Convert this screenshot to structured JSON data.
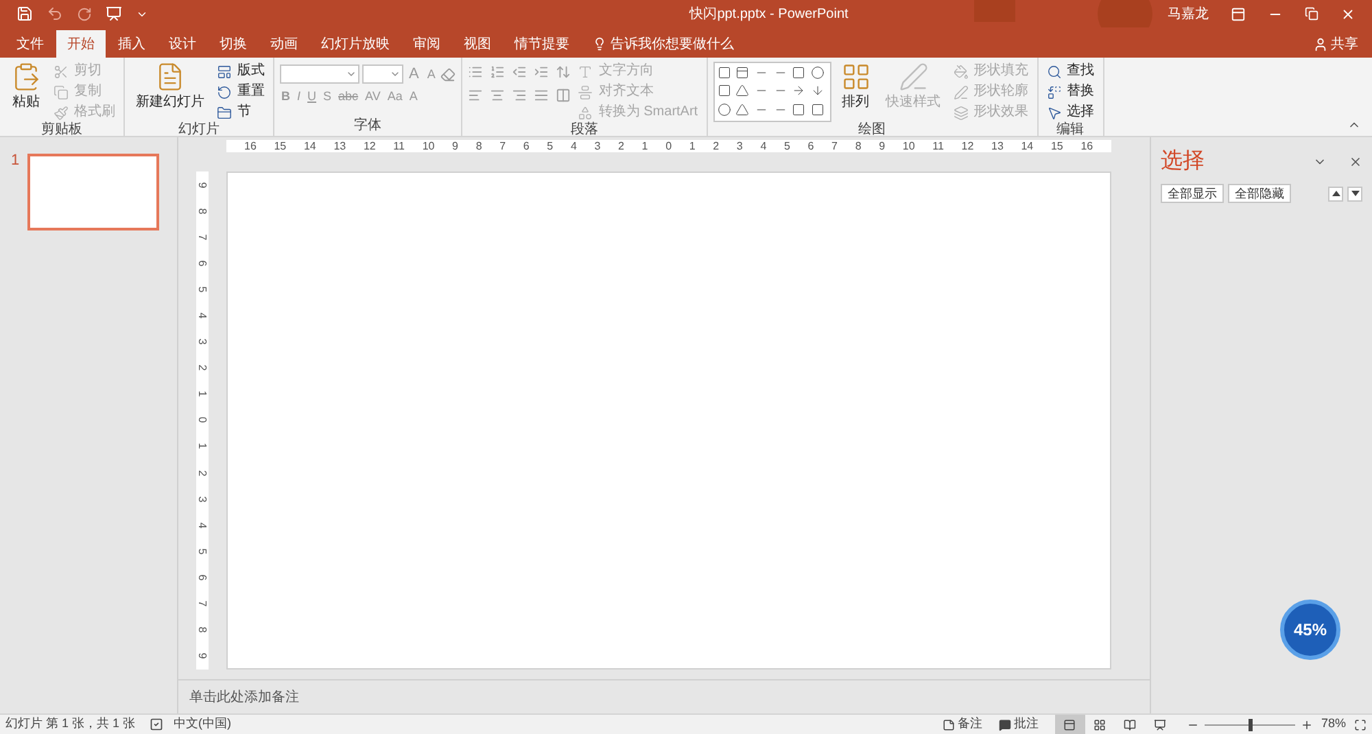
{
  "title_bar": {
    "title": "快闪ppt.pptx - PowerPoint",
    "user": "马嘉龙"
  },
  "tabs": [
    {
      "label": "文件",
      "selected": false
    },
    {
      "label": "开始",
      "selected": true
    },
    {
      "label": "插入",
      "selected": false
    },
    {
      "label": "设计",
      "selected": false
    },
    {
      "label": "切换",
      "selected": false
    },
    {
      "label": "动画",
      "selected": false
    },
    {
      "label": "幻灯片放映",
      "selected": false
    },
    {
      "label": "审阅",
      "selected": false
    },
    {
      "label": "视图",
      "selected": false
    },
    {
      "label": "情节提要",
      "selected": false
    }
  ],
  "tell_me": "告诉我你想要做什么",
  "share": "共享",
  "ribbon": [
    {
      "kind": "clipboard",
      "label": "剪贴板",
      "large": [
        {
          "label": "粘贴",
          "disabled": false
        }
      ],
      "items": [
        {
          "label": "剪切",
          "disabled": true
        },
        {
          "label": "复制",
          "disabled": true
        },
        {
          "label": "格式刷",
          "disabled": true
        }
      ]
    },
    {
      "kind": "slides",
      "label": "幻灯片",
      "large": [
        {
          "label": "新建幻灯片",
          "disabled": false
        }
      ],
      "items": [
        {
          "label": "版式",
          "disabled": false
        },
        {
          "label": "重置",
          "disabled": false
        },
        {
          "label": "节",
          "disabled": false
        }
      ]
    },
    {
      "kind": "font",
      "label": "字体",
      "glyphs_top": [
        "A",
        "A"
      ],
      "glyphs": [
        "B",
        "I",
        "U",
        "S",
        "abc",
        "AV",
        "Aa",
        "A"
      ]
    },
    {
      "kind": "paragraph",
      "label": "段落",
      "items": [
        {
          "label": "文字方向",
          "disabled": true
        },
        {
          "label": "对齐文本",
          "disabled": true
        },
        {
          "label": "转换为 SmartArt",
          "disabled": true
        }
      ]
    },
    {
      "kind": "drawing",
      "label": "绘图",
      "large": [
        {
          "label": "排列",
          "disabled": false
        },
        {
          "label": "快速样式",
          "disabled": true
        }
      ],
      "items": [
        {
          "label": "形状填充",
          "disabled": true
        },
        {
          "label": "形状轮廓",
          "disabled": true
        },
        {
          "label": "形状效果",
          "disabled": true
        }
      ]
    },
    {
      "kind": "editing",
      "label": "编辑",
      "items": [
        {
          "label": "查找",
          "disabled": false
        },
        {
          "label": "替换",
          "disabled": false
        },
        {
          "label": "选择",
          "disabled": false
        }
      ]
    }
  ],
  "thumbnails": [
    {
      "number": "1",
      "selected": true
    }
  ],
  "ruler_h": [
    "16",
    "15",
    "14",
    "13",
    "12",
    "11",
    "10",
    "9",
    "8",
    "7",
    "6",
    "5",
    "4",
    "3",
    "2",
    "1",
    "0",
    "1",
    "2",
    "3",
    "4",
    "5",
    "6",
    "7",
    "8",
    "9",
    "10",
    "11",
    "12",
    "13",
    "14",
    "15",
    "16"
  ],
  "ruler_v": [
    "9",
    "8",
    "7",
    "6",
    "5",
    "4",
    "3",
    "2",
    "1",
    "0",
    "1",
    "2",
    "3",
    "4",
    "5",
    "6",
    "7",
    "8",
    "9"
  ],
  "notes_placeholder": "单击此处添加备注",
  "selection_pane": {
    "title": "选择",
    "buttons": [
      "全部显示",
      "全部隐藏"
    ]
  },
  "floating_widget": {
    "text": "45%"
  },
  "status_bar": {
    "slide_info": "幻灯片 第 1 张，共 1 张",
    "language": "中文(中国)",
    "notes": "备注",
    "comments": "批注",
    "views": [
      {
        "kind": "normal",
        "selected": true
      },
      {
        "kind": "sorter",
        "selected": false
      },
      {
        "kind": "reading",
        "selected": false
      },
      {
        "kind": "slideshow",
        "selected": false
      }
    ],
    "zoom": {
      "level": 0.5,
      "reading": "78%"
    }
  }
}
